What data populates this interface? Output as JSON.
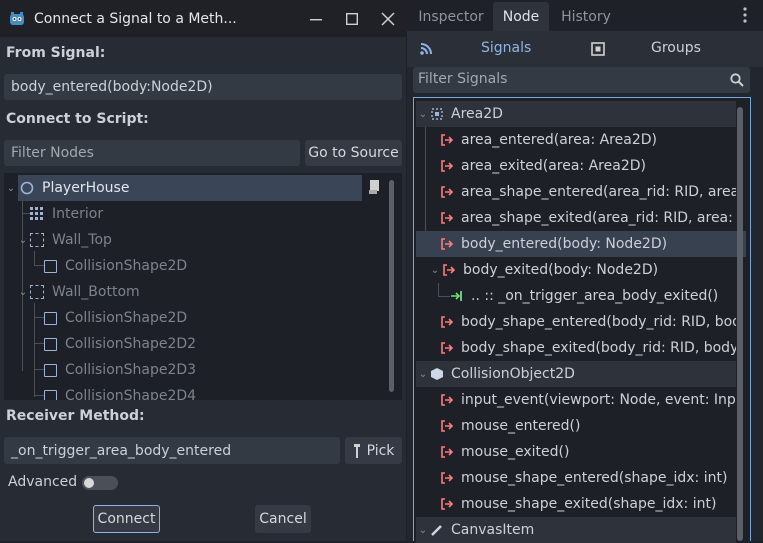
{
  "dialog": {
    "title": "Connect a Signal to a Meth...",
    "from_signal_label": "From Signal:",
    "from_signal_value": "body_entered(body:Node2D)",
    "connect_to_script_label": "Connect to Script:",
    "filter_nodes_placeholder": "Filter Nodes",
    "go_to_source": "Go to Source",
    "tree": [
      {
        "label": "PlayerHouse"
      },
      {
        "label": "Interior"
      },
      {
        "label": "Wall_Top"
      },
      {
        "label": "CollisionShape2D"
      },
      {
        "label": "Wall_Bottom"
      },
      {
        "label": "CollisionShape2D"
      },
      {
        "label": "CollisionShape2D2"
      },
      {
        "label": "CollisionShape2D3"
      },
      {
        "label": "CollisionShape2D4"
      }
    ],
    "receiver_method_label": "Receiver Method:",
    "receiver_method_value": "_on_trigger_area_body_entered",
    "pick_label": "Pick",
    "advanced_label": "Advanced",
    "connect_label": "Connect",
    "cancel_label": "Cancel"
  },
  "dock": {
    "tabs": [
      "Inspector",
      "Node",
      "History"
    ],
    "active_tab": "Node",
    "signals_label": "Signals",
    "groups_label": "Groups",
    "filter_signals_placeholder": "Filter Signals",
    "rows": [
      {
        "label": "Area2D",
        "kind": "header"
      },
      {
        "label": "area_entered(area: Area2D)",
        "kind": "signal"
      },
      {
        "label": "area_exited(area: Area2D)",
        "kind": "signal"
      },
      {
        "label": "area_shape_entered(area_rid: RID, area:...",
        "kind": "signal"
      },
      {
        "label": "area_shape_exited(area_rid: RID, area: ...",
        "kind": "signal"
      },
      {
        "label": "body_entered(body: Node2D)",
        "kind": "signal"
      },
      {
        "label": "body_exited(body: Node2D)",
        "kind": "signal"
      },
      {
        "label": ".. :: _on_trigger_area_body_exited()",
        "kind": "connection"
      },
      {
        "label": "body_shape_entered(body_rid: RID, bod...",
        "kind": "signal"
      },
      {
        "label": "body_shape_exited(body_rid: RID, body:...",
        "kind": "signal"
      },
      {
        "label": "CollisionObject2D",
        "kind": "header"
      },
      {
        "label": "input_event(viewport: Node, event: Inp...",
        "kind": "signal"
      },
      {
        "label": "mouse_entered()",
        "kind": "signal"
      },
      {
        "label": "mouse_exited()",
        "kind": "signal"
      },
      {
        "label": "mouse_shape_entered(shape_idx: int)",
        "kind": "signal"
      },
      {
        "label": "mouse_shape_exited(shape_idx: int)",
        "kind": "signal"
      },
      {
        "label": "CanvasItem",
        "kind": "header"
      }
    ]
  },
  "colors": {
    "signal_icon": "#ff7b7b",
    "connection_icon": "#6fe07a",
    "accent": "#7aa6d6"
  }
}
